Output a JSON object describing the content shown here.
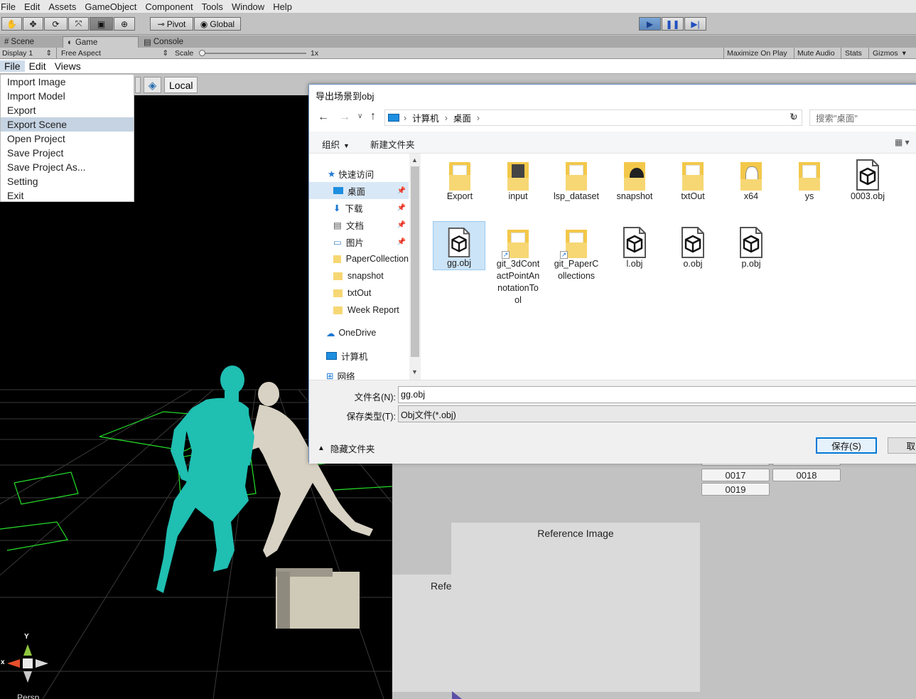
{
  "menubar": [
    "File",
    "Edit",
    "Assets",
    "GameObject",
    "Component",
    "Tools",
    "Window",
    "Help"
  ],
  "toolbar": {
    "pivot": "Pivot",
    "global": "Global"
  },
  "tabs": {
    "scene": "Scene",
    "game": "Game",
    "console": "Console"
  },
  "gamebar": {
    "display": "Display 1",
    "aspect": "Free Aspect",
    "scale_label": "Scale",
    "scale_value": "1x",
    "maximize": "Maximize On Play",
    "mute": "Mute Audio",
    "stats": "Stats",
    "gizmos": "Gizmos"
  },
  "viewmenu": [
    "File",
    "Edit",
    "Views"
  ],
  "file_menu": [
    "Import Image",
    "Import Model",
    "Export",
    "Export Scene",
    "Open Project",
    "Save Project",
    "Save Project As...",
    "Setting",
    "Exit"
  ],
  "scene": {
    "local_label": "Local",
    "gizmo_y": "Y",
    "gizmo_x": "x",
    "persp": "Persp"
  },
  "dialog": {
    "title": "导出场景到obj",
    "path": [
      "计算机",
      "桌面"
    ],
    "search_placeholder": "搜索\"桌面\"",
    "organize": "组织",
    "new_folder": "新建文件夹",
    "nav": {
      "quick_access": "快速访问",
      "desktop": "桌面",
      "downloads": "下载",
      "documents": "文档",
      "pictures": "图片",
      "paper": "PaperCollection",
      "snapshot": "snapshot",
      "txtout": "txtOut",
      "week": "Week Report",
      "onedrive": "OneDrive",
      "computer": "计算机",
      "network": "网络"
    },
    "files": [
      "Export",
      "input",
      "lsp_dataset",
      "snapshot",
      "txtOut",
      "x64",
      "ys",
      "0003.obj",
      "gg.obj",
      "git_3dContactPointAnnotationTool",
      "git_PaperCollections",
      "l.obj",
      "o.obj",
      "p.obj"
    ],
    "filename_label": "文件名(N):",
    "filename_value": "gg.obj",
    "filetype_label": "保存类型(T):",
    "filetype_value": "Obj文件(*.obj)",
    "hide_folders": "隐藏文件夹",
    "save": "保存(S)",
    "cancel": "取"
  },
  "panel": {
    "b17": "0017",
    "b18": "0018",
    "b19": "0019",
    "reference": "Reference Image",
    "reference_cut": "Refe"
  },
  "colors": {
    "accent": "#0078d7",
    "menu_highlight": "#c5d3e2",
    "scene_bg": "#000000",
    "cyan_model": "#1fbfb2",
    "beige_model": "#d8d2c4"
  }
}
